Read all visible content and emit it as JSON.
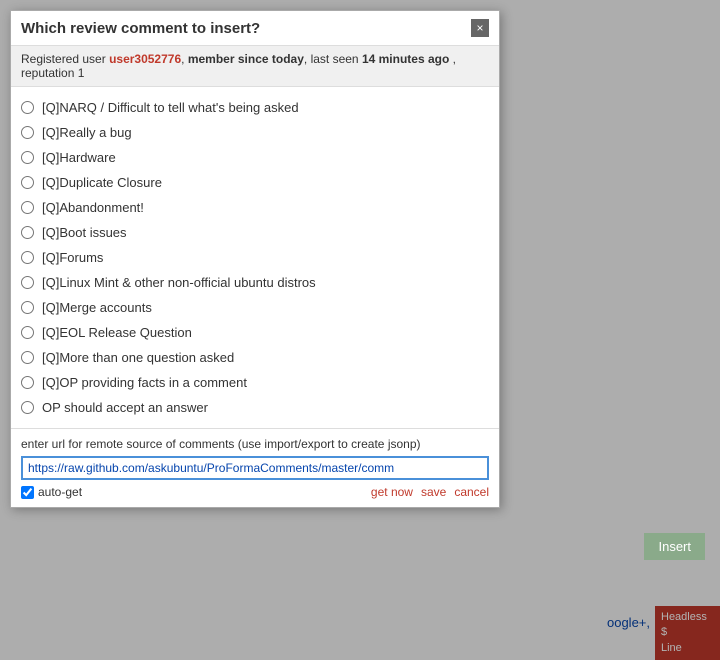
{
  "modal": {
    "title": "Which review comment to insert?",
    "close_label": "×",
    "user_info": {
      "prefix": "Registered",
      "type": "user",
      "username": "user3052776",
      "comma": ",",
      "member_text": "member",
      "since_text": "since today",
      "last_seen_prefix": ", last seen",
      "last_seen": "14 minutes ago",
      "reputation_prefix": ", reputation",
      "reputation": "1"
    },
    "options": [
      {
        "id": "opt1",
        "label": "[Q]NARQ / Difficult to tell what's being asked"
      },
      {
        "id": "opt2",
        "label": "[Q]Really a bug"
      },
      {
        "id": "opt3",
        "label": "[Q]Hardware"
      },
      {
        "id": "opt4",
        "label": "[Q]Duplicate Closure"
      },
      {
        "id": "opt5",
        "label": "[Q]Abandonment!"
      },
      {
        "id": "opt6",
        "label": "[Q]Boot issues"
      },
      {
        "id": "opt7",
        "label": "[Q]Forums"
      },
      {
        "id": "opt8",
        "label": "[Q]Linux Mint & other non-official ubuntu distros"
      },
      {
        "id": "opt9",
        "label": "[Q]Merge accounts"
      },
      {
        "id": "opt10",
        "label": "[Q]EOL Release Question"
      },
      {
        "id": "opt11",
        "label": "[Q]More than one question asked"
      },
      {
        "id": "opt12",
        "label": "[Q]OP providing facts in a comment"
      },
      {
        "id": "opt13",
        "label": "OP should accept an answer"
      }
    ],
    "footer": {
      "url_description": "enter url for remote source of comments (use import/export to create jsonp)",
      "url_value": "https://raw.github.com/askubuntu/ProFormaComments/master/comm",
      "url_placeholder": "https://raw.github.com/askubuntu/ProFormaComments/master/comm",
      "auto_get_label": "auto-get",
      "actions": {
        "get_now": "get now",
        "save": "save",
        "cancel": "cancel"
      }
    }
  },
  "insert_button": "Insert",
  "headless_line": "Headless $\nLine",
  "bg_link": "oogle+,"
}
